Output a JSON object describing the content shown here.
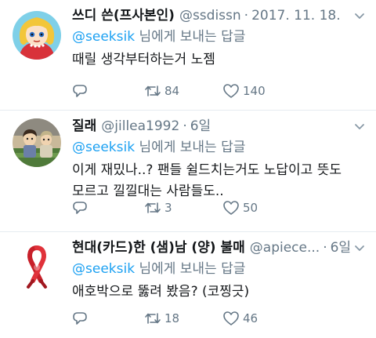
{
  "colors": {
    "accent": "#1da1f2",
    "secondary_text": "#657786",
    "primary_text": "#14171a",
    "divider": "#e6ecf0"
  },
  "reply_to": {
    "mention": "@seeksik",
    "suffix": " 님에게 보내는 답글"
  },
  "tweets": [
    {
      "display_name": "쓰디 쓴(프사본인)",
      "handle": "@ssdissn",
      "separator": "·",
      "time": "2017. 11. 18.",
      "text": "때릴 생각부터하는거 노젬",
      "replies": "",
      "retweets": "84",
      "likes": "140",
      "avatar_icon": "cartoon-girl-avatar"
    },
    {
      "display_name": "질래",
      "handle": "@jillea1992",
      "separator": "·",
      "time": "6일",
      "text": "이게 재밌나..? 팬들 쉴드치는거도 노답이고 뜻도 모르고 낄낄대는 사람들도..",
      "replies": "",
      "retweets": "3",
      "likes": "50",
      "avatar_icon": "cartoon-scene-avatar"
    },
    {
      "display_name": "현대(카드)한 (샘)남 (양) 불매",
      "handle": "@apiece...",
      "separator": "·",
      "time": "6일",
      "text": "애호박으로 뚫려 봤음? (코찡긋)",
      "replies": "",
      "retweets": "18",
      "likes": "46",
      "avatar_icon": "red-ribbon-avatar"
    }
  ]
}
